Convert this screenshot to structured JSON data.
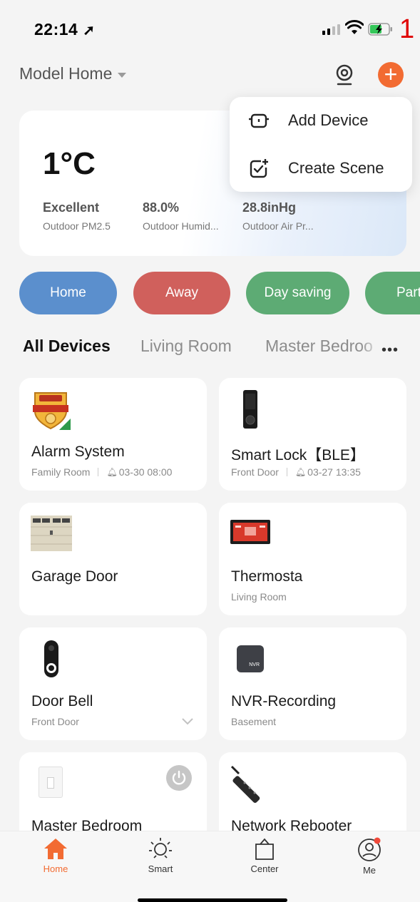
{
  "status_bar": {
    "time": "22:14",
    "annotation": "1"
  },
  "header": {
    "home_name": "Model Home"
  },
  "weather": {
    "temperature": "1°C",
    "stats": [
      {
        "value": "Excellent",
        "label": "Outdoor PM2.5"
      },
      {
        "value": "88.0%",
        "label": "Outdoor Humid..."
      },
      {
        "value": "28.8inHg",
        "label": "Outdoor Air Pr..."
      }
    ]
  },
  "add_menu": {
    "items": [
      {
        "label": "Add Device",
        "icon": "add-device-icon"
      },
      {
        "label": "Create Scene",
        "icon": "create-scene-icon"
      }
    ]
  },
  "scenes": [
    {
      "label": "Home",
      "color": "#5b8fcd"
    },
    {
      "label": "Away",
      "color": "#d0605c"
    },
    {
      "label": "Day saving",
      "color": "#5dab74"
    },
    {
      "label": "Part",
      "color": "#5dab74"
    }
  ],
  "rooms": {
    "tabs": [
      "All Devices",
      "Living Room",
      "Master Bedroo"
    ],
    "active": "All Devices",
    "more": "•••"
  },
  "devices": [
    {
      "name": "Alarm System",
      "room": "Family Room",
      "alert": "03-30 08:00"
    },
    {
      "name": "Smart Lock【BLE】",
      "room": "Front Door",
      "alert": "03-27 13:35"
    },
    {
      "name": "Garage Door",
      "room": ""
    },
    {
      "name": "Thermosta",
      "room": "Living Room"
    },
    {
      "name": "Door Bell",
      "room": "Front Door"
    },
    {
      "name": "NVR-Recording",
      "room": "Basement",
      "badge": "NVR"
    },
    {
      "name": "Master Bedroom",
      "room": ""
    },
    {
      "name": "Network Rebooter",
      "room": ""
    }
  ],
  "bottom_nav": [
    {
      "label": "Home",
      "icon": "home-icon",
      "active": true
    },
    {
      "label": "Smart",
      "icon": "sun-icon",
      "active": false
    },
    {
      "label": "Center",
      "icon": "shopping-bag-icon",
      "active": false
    },
    {
      "label": "Me",
      "icon": "profile-icon",
      "active": false
    }
  ],
  "colors": {
    "accent": "#f26b32",
    "highlight_box": "#e00000"
  }
}
